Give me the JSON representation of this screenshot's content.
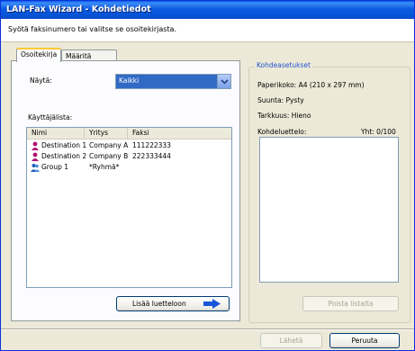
{
  "window": {
    "title": "LAN-Fax Wizard - Kohdetiedot"
  },
  "instruction": "Syötä faksinumero tai valitse se osoitekirjasta.",
  "tabs": [
    {
      "label": "Osoitekirja",
      "active": true
    },
    {
      "label": "Määritä kohde",
      "active": false
    }
  ],
  "filter": {
    "label": "Näytä:",
    "selected": "Kaikki"
  },
  "user_list": {
    "label": "Käyttäjälista:",
    "columns": [
      "Nimi",
      "Yritys",
      "Faksi"
    ],
    "rows": [
      {
        "icon": "person-icon",
        "name": "Destination 1",
        "company": "Company A",
        "fax": "111222333"
      },
      {
        "icon": "person-icon",
        "name": "Destination 2",
        "company": "Company B",
        "fax": "222333444"
      },
      {
        "icon": "group-icon",
        "name": "Group 1",
        "company": "*Ryhmä*",
        "fax": ""
      }
    ]
  },
  "add_button": {
    "label": "Lisää luetteloon",
    "icon": "arrow-right-icon"
  },
  "settings": {
    "title": "Kohdeasetukset",
    "paper_size": "Paperikoko: A4 (210 x 297 mm)",
    "orientation": "Suunta: Pysty",
    "resolution": "Tarkkuus: Hieno",
    "destination_list_label": "Kohdeluettelo:",
    "total": "Yht: 0/100",
    "remove_button": "Poista listalta"
  },
  "footer": {
    "send_button": "Lähetä",
    "cancel_button": "Peruuta"
  },
  "colors": {
    "accent": "#316AC5",
    "titlebar": "#0A5FE8",
    "person_icon": "#B01070",
    "group_icon": "#1F63B8"
  }
}
